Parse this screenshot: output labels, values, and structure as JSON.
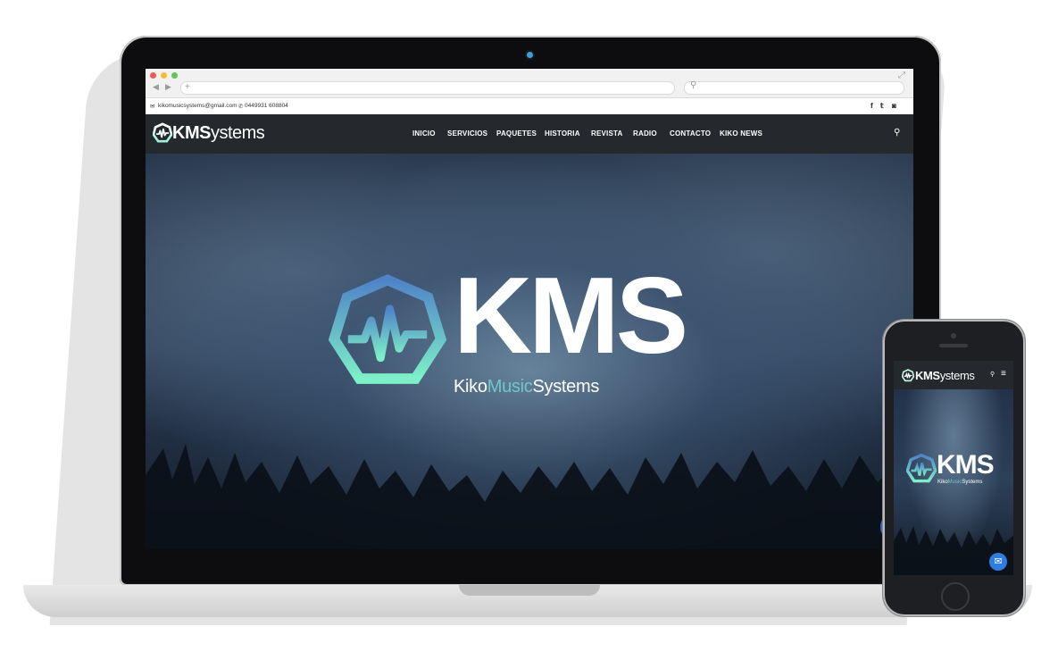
{
  "contact_bar": {
    "email": "kikomusicsystems@gmail.com",
    "phone": "0449931 608804",
    "social_icons": [
      "facebook-icon",
      "twitter-icon",
      "instagram-icon"
    ],
    "social_glyphs": [
      "f",
      "𝕥",
      "◙"
    ]
  },
  "site_nav": {
    "logo_bold": "KMS",
    "logo_light": "ystems",
    "items": [
      "INICIO",
      "SERVICIOS",
      "PAQUETES",
      "HISTORIA",
      "REVISTA",
      "RADIO",
      "CONTACTO",
      "KIKO NEWS"
    ]
  },
  "hero": {
    "wordmark": "KMS",
    "sub_kiko": "Kiko",
    "sub_music": "Music",
    "sub_systems": "Systems"
  },
  "phone": {
    "logo_bold": "KMS",
    "logo_light": "ystems",
    "wordmark": "KMS",
    "sub_kiko": "Kiko",
    "sub_music": "Music",
    "sub_systems": "Systems",
    "messenger_icon": "messenger-icon"
  },
  "colors": {
    "accent_teal": "#6fc7c9",
    "nav_bg": "#25282c",
    "logo_gradient_top": "#4f83c8",
    "logo_gradient_bottom": "#7ef0c8",
    "messenger_blue": "#2f7de1"
  }
}
